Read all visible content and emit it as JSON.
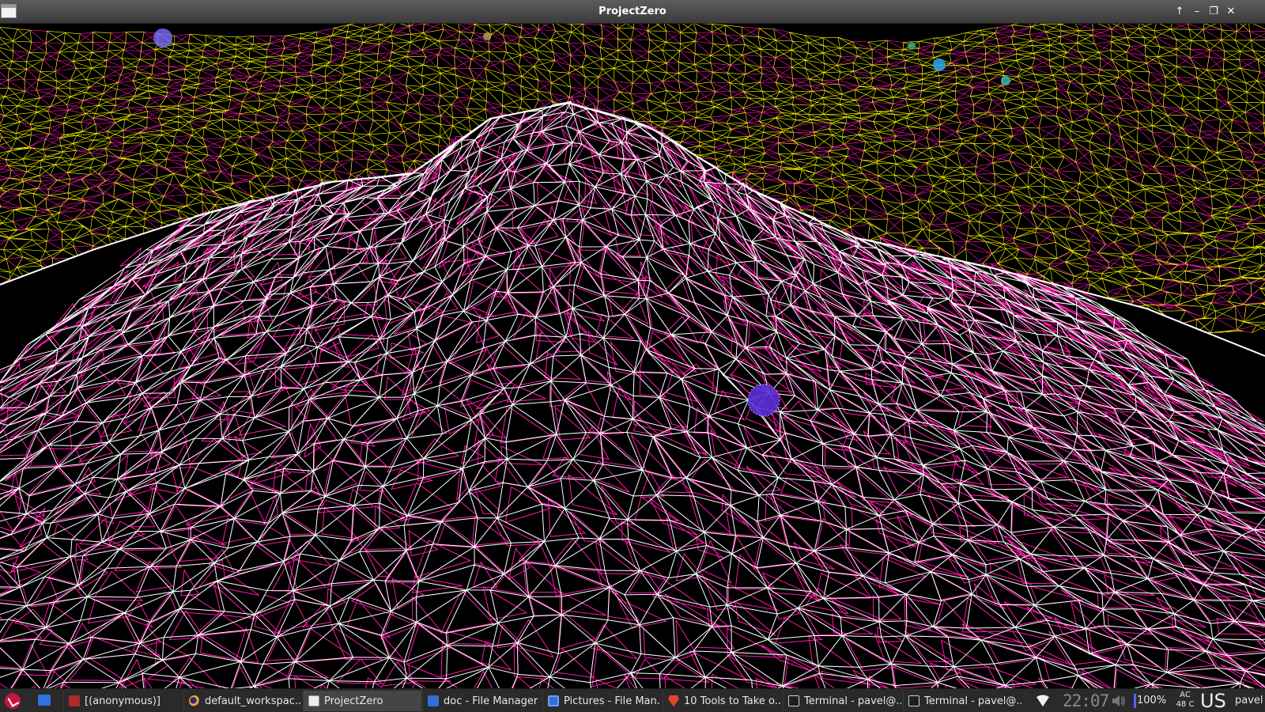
{
  "window": {
    "title": "ProjectZero",
    "controls": {
      "keep_above_icon": "arrow-up-icon",
      "minimize_icon": "minimize-icon",
      "maximize_icon": "restore-icon",
      "close_icon": "close-icon"
    }
  },
  "scene": {
    "description_colors": {
      "background": "#000000",
      "near_mesh_primary": "#ffffff",
      "near_mesh_secondary": "#ff1aa8",
      "far_mesh_primary": "#ffff00",
      "far_mesh_secondary": "#ff1aa8",
      "sphere": "#8a5cff"
    }
  },
  "taskbar": {
    "menu_icon": "app-menu-icon",
    "show_desktop_icon": "desktop-icon",
    "tasks": [
      {
        "label": "[(anonymous)]",
        "icon": "pdf-icon",
        "active": false
      },
      {
        "label": "default_workspac...",
        "icon": "eclipse-icon",
        "active": false
      },
      {
        "label": "ProjectZero",
        "icon": "window-icon",
        "active": true
      },
      {
        "label": "doc - File Manager",
        "icon": "folder-icon",
        "active": false
      },
      {
        "label": "Pictures - File Man...",
        "icon": "pictures-folder-icon",
        "active": false
      },
      {
        "label": "10 Tools to Take o...",
        "icon": "brave-browser-icon",
        "active": false
      },
      {
        "label": "Terminal - pavel@...",
        "icon": "terminal-icon",
        "active": false
      },
      {
        "label": "Terminal - pavel@...",
        "icon": "terminal-icon",
        "active": false
      }
    ],
    "tray": {
      "clock": "22:07",
      "battery": "100%",
      "ac_line1": "AC",
      "ac_line2": "48 C",
      "keyboard_layout": "US",
      "user": "pavel"
    }
  }
}
